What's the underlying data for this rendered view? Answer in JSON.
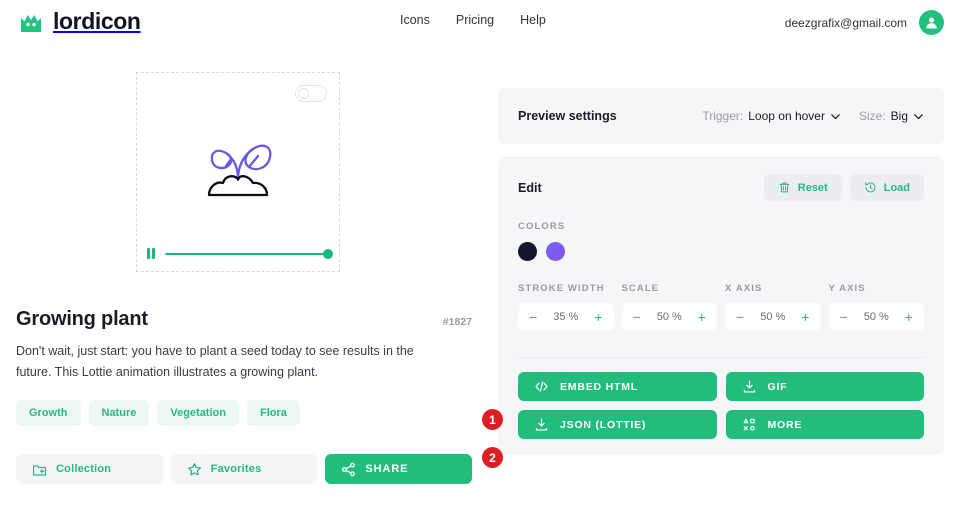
{
  "brand": {
    "name": "lordicon",
    "logo_icon": "crown-icon",
    "color": "#24c37f"
  },
  "nav": {
    "items": [
      {
        "label": "Icons",
        "name": "nav-item-icons"
      },
      {
        "label": "Pricing",
        "name": "nav-item-pricing"
      },
      {
        "label": "Help",
        "name": "nav-item-help"
      }
    ]
  },
  "account": {
    "email": "deezgrafix@gmail.com",
    "avatar_icon": "user-avatar-icon"
  },
  "preview": {
    "toggle_state": "off",
    "animation_icon": "growing-plant-icon",
    "player": {
      "state_icon": "pause-icon",
      "progress_percent": 100
    }
  },
  "icon_details": {
    "title": "Growing plant",
    "id": "#1827",
    "description": "Don't wait, just start: you have to plant a seed today to see results in the future. This Lottie animation illustrates a growing plant.",
    "tags": [
      "Growth",
      "Nature",
      "Vegetation",
      "Flora"
    ]
  },
  "actions": [
    {
      "label": "Collection",
      "icon": "folder-plus-icon",
      "name": "collection-button"
    },
    {
      "label": "Favorites",
      "icon": "star-icon",
      "name": "favorites-button"
    },
    {
      "label": "SHARE",
      "icon": "share-icon",
      "name": "share-button"
    }
  ],
  "preview_settings": {
    "title": "Preview settings",
    "trigger": {
      "key": "Trigger:",
      "value": "Loop on hover",
      "icon": "chevron-down-icon"
    },
    "size": {
      "key": "Size:",
      "value": "Big",
      "icon": "chevron-down-icon"
    }
  },
  "edit": {
    "title": "Edit",
    "reset_label": "Reset",
    "reset_icon": "trash-icon",
    "load_label": "Load",
    "load_icon": "history-icon",
    "colors_label": "COLORS",
    "colors": [
      "#15152b",
      "#7a5cf0"
    ],
    "steppers": [
      {
        "label": "STROKE WIDTH",
        "value": "35 %",
        "name": "stroke-width-stepper"
      },
      {
        "label": "SCALE",
        "value": "50 %",
        "name": "scale-stepper"
      },
      {
        "label": "X AXIS",
        "value": "50 %",
        "name": "x-axis-stepper"
      },
      {
        "label": "Y AXIS",
        "value": "50 %",
        "name": "y-axis-stepper"
      }
    ],
    "minus": "−",
    "plus": "+"
  },
  "exports": [
    {
      "label": "EMBED HTML",
      "icon": "code-icon",
      "name": "embed-html-button"
    },
    {
      "label": "GIF",
      "icon": "download-icon",
      "name": "gif-button"
    },
    {
      "label": "JSON (LOTTIE)",
      "icon": "download-icon",
      "name": "json-lottie-button"
    },
    {
      "label": "MORE",
      "icon": "shapes-icon",
      "name": "more-button"
    }
  ],
  "annotations": [
    {
      "number": "1",
      "name": "annotation-badge-1"
    },
    {
      "number": "2",
      "name": "annotation-badge-2"
    }
  ]
}
